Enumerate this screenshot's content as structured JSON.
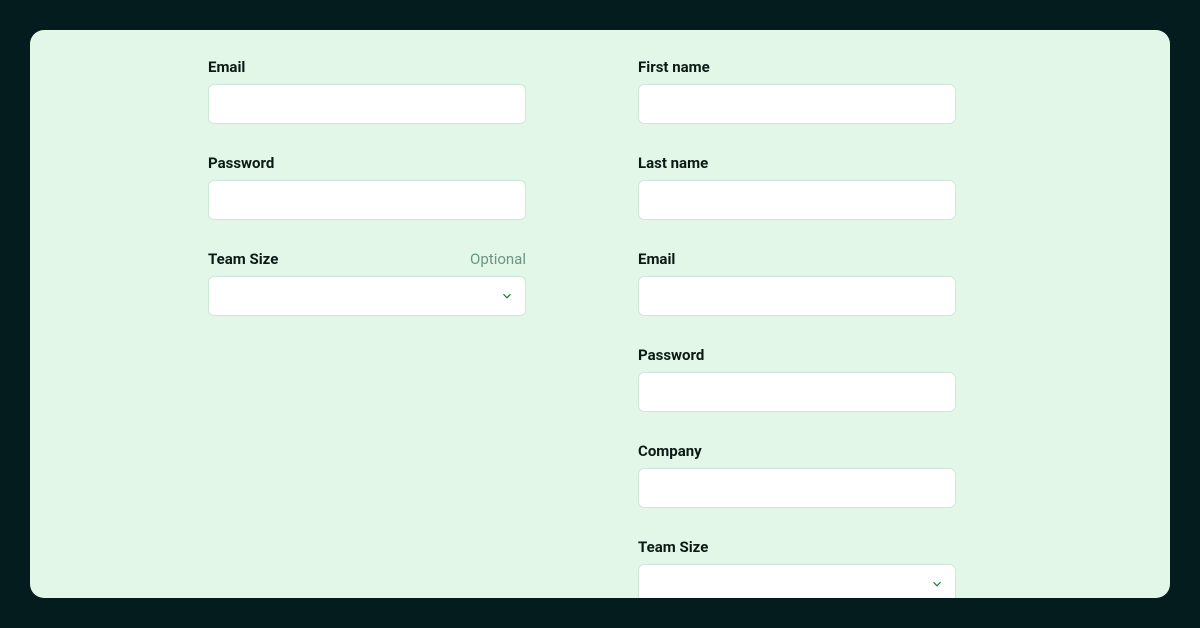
{
  "left": {
    "email": {
      "label": "Email",
      "value": ""
    },
    "password": {
      "label": "Password",
      "value": ""
    },
    "team_size": {
      "label": "Team Size",
      "hint": "Optional",
      "value": ""
    }
  },
  "right": {
    "first_name": {
      "label": "First name",
      "value": ""
    },
    "last_name": {
      "label": "Last name",
      "value": ""
    },
    "email": {
      "label": "Email",
      "value": ""
    },
    "password": {
      "label": "Password",
      "value": ""
    },
    "company": {
      "label": "Company",
      "value": ""
    },
    "team_size": {
      "label": "Team Size",
      "value": ""
    }
  },
  "colors": {
    "page_bg": "#051c1f",
    "card_bg": "#e2f7e7",
    "input_bg": "#ffffff",
    "input_border": "#cfe7d7",
    "label_text": "#0b1a17",
    "hint_text": "#6a9584",
    "chevron": "#0a7a3a"
  }
}
